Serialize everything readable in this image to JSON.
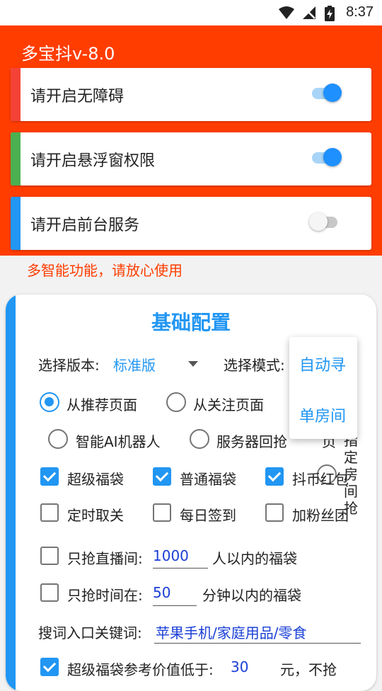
{
  "status_bar": {
    "time": "8:37"
  },
  "app": {
    "title": "多宝抖v-8.0"
  },
  "permissions": [
    {
      "label": "请开启无障碍",
      "on": true,
      "accent": "#f44336"
    },
    {
      "label": "请开启悬浮窗权限",
      "on": true,
      "accent": "#4caf50"
    },
    {
      "label": "请开启前台服务",
      "on": false,
      "accent": "#2196f3"
    }
  ],
  "notice": "多智能功能，请放心使用",
  "config": {
    "title": "基础配置",
    "version_label": "选择版本:",
    "version_value": "标准版",
    "mode_label": "选择模式:",
    "mode_options": [
      "自动寻",
      "单房间"
    ],
    "source_options": [
      {
        "label": "从推荐页面",
        "checked": true
      },
      {
        "label": "从关注页面",
        "checked": false
      }
    ],
    "bot_options": [
      {
        "label": "智能AI机器人",
        "checked": false
      },
      {
        "label": "服务器回抢",
        "checked": false
      },
      {
        "label": "页",
        "checked": false
      }
    ],
    "vertical_option": "指定房间抢",
    "bag_options": [
      {
        "label": "超级福袋",
        "checked": true
      },
      {
        "label": "普通福袋",
        "checked": true
      },
      {
        "label": "抖币红包",
        "checked": true
      }
    ],
    "extra_options": [
      {
        "label": "定时取关",
        "checked": false
      },
      {
        "label": "每日签到",
        "checked": false
      },
      {
        "label": "加粉丝团",
        "checked": false
      }
    ],
    "live_filter": {
      "prefix": "只抢直播间:",
      "value": "1000",
      "suffix": "人以内的福袋",
      "checked": false
    },
    "time_filter": {
      "prefix": "只抢时间在:",
      "value": "50",
      "suffix": "分钟以内的福袋",
      "checked": false
    },
    "keyword": {
      "label": "搜词入口关键词:",
      "value": "苹果手机/家庭用品/零食"
    },
    "value_filter": {
      "prefix": "超级福袋参考价值低于:",
      "value": "30",
      "suffix": "元，不抢",
      "checked": true
    }
  },
  "colors": {
    "header": "#ff3d00",
    "accent": "#2196f3",
    "input_text": "#1a3fd6"
  }
}
